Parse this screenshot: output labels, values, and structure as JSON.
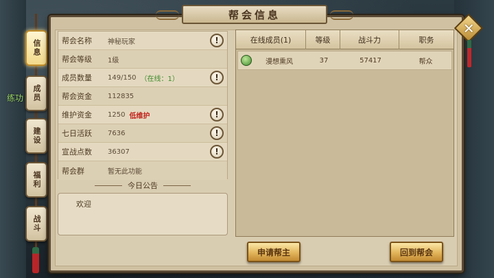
{
  "title": "帮会信息",
  "scene": {
    "floating_text": "练功"
  },
  "close": {
    "glyph": "✕"
  },
  "side_tabs": [
    {
      "label": "信息",
      "active": true
    },
    {
      "label": "成员",
      "active": false
    },
    {
      "label": "建设",
      "active": false
    },
    {
      "label": "福利",
      "active": false
    },
    {
      "label": "战斗",
      "active": false
    }
  ],
  "guild_info": {
    "rows": [
      {
        "label": "帮会名称",
        "value": "神秘玩家",
        "note": "",
        "warn": true
      },
      {
        "label": "帮会等级",
        "value": "1级",
        "note": "",
        "warn": false
      },
      {
        "label": "成员数量",
        "value": "149/150",
        "note": "（在线：1）",
        "warn": true
      },
      {
        "label": "帮会资金",
        "value": "112835",
        "note": "",
        "warn": false
      },
      {
        "label": "维护资金",
        "value": "1250",
        "note": "低维护",
        "warn": true
      },
      {
        "label": "七日活跃",
        "value": "7636",
        "note": "",
        "warn": true
      },
      {
        "label": "宣战点数",
        "value": "36307",
        "note": "",
        "warn": true
      },
      {
        "label": "帮会群",
        "value": "暂无此功能",
        "note": "",
        "warn": false
      }
    ],
    "warn_glyph": "!"
  },
  "notice": {
    "header": "今日公告",
    "content": "欢迎"
  },
  "members": {
    "columns": [
      "在线成员(1)",
      "等级",
      "战斗力",
      "职务"
    ],
    "rows": [
      {
        "name": "漫想熏风",
        "level": "37",
        "power": "57417",
        "role": "帮众"
      }
    ]
  },
  "buttons": {
    "apply_leader": "申请帮主",
    "return_guild": "回到帮会"
  },
  "colors": {
    "panel": "#cfc1a2",
    "accent_gold": "#e2b55b",
    "online_green": "#3b8a2a",
    "warning_red": "#c0241c"
  }
}
